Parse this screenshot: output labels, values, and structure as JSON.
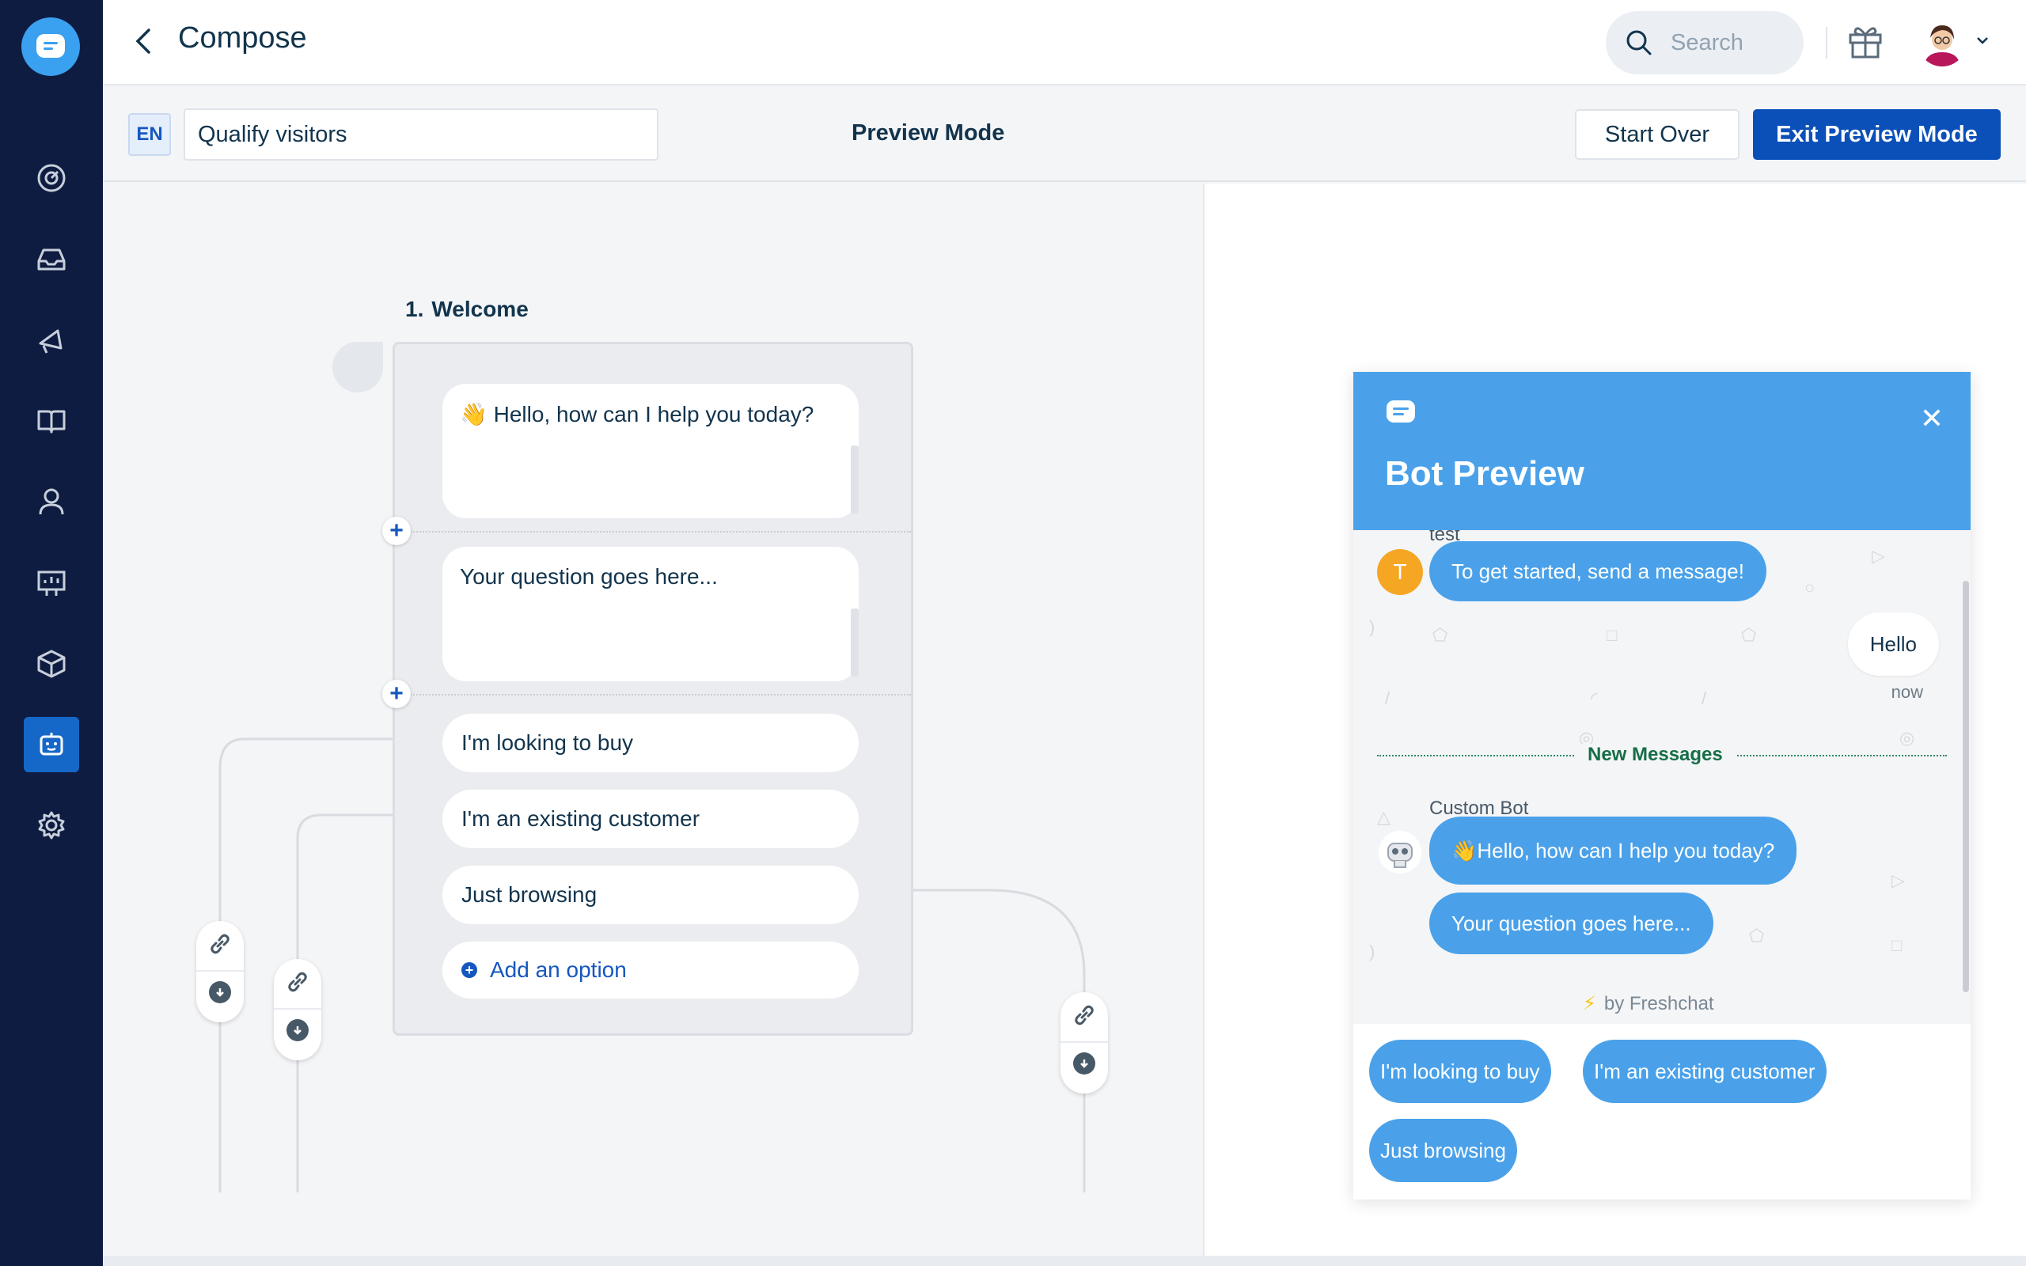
{
  "topbar": {
    "title": "Compose",
    "search_placeholder": "Search"
  },
  "sidebar": {
    "items": [
      {
        "name": "dashboard-icon"
      },
      {
        "name": "inbox-icon"
      },
      {
        "name": "campaigns-icon"
      },
      {
        "name": "knowledge-base-icon"
      },
      {
        "name": "contacts-icon"
      },
      {
        "name": "reports-icon"
      },
      {
        "name": "integrations-icon"
      },
      {
        "name": "bots-icon",
        "active": true
      },
      {
        "name": "settings-icon"
      }
    ]
  },
  "subheader": {
    "lang": "EN",
    "bot_name": "Qualify visitors",
    "mode_label": "Preview Mode",
    "start_over": "Start Over",
    "exit_preview": "Exit Preview Mode"
  },
  "flow": {
    "step_number": "1.",
    "step_title": "Welcome",
    "message_1": "👋 Hello, how can I help you today?",
    "message_2": "Your question goes here...",
    "options": [
      "I'm looking to buy",
      "I'm an existing customer",
      "Just browsing"
    ],
    "add_option": "Add an option"
  },
  "preview": {
    "title": "Bot Preview",
    "user_name": "test",
    "user_initial": "T",
    "user_message": "To get started, send a message!",
    "visitor_message": "Hello",
    "visitor_time": "now",
    "new_messages": "New Messages",
    "bot_name": "Custom Bot",
    "bot_message_1": "👋Hello, how can I help you today?",
    "bot_message_2": "Your question goes here...",
    "powered_by": "by Freshchat",
    "quick_replies": [
      "I'm looking to buy",
      "I'm an existing customer",
      "Just browsing"
    ]
  },
  "colors": {
    "sidebar_bg": "#0f1c41",
    "accent": "#1668c8",
    "primary_button": "#0b50b8",
    "preview_blue": "#4aa1e9"
  }
}
